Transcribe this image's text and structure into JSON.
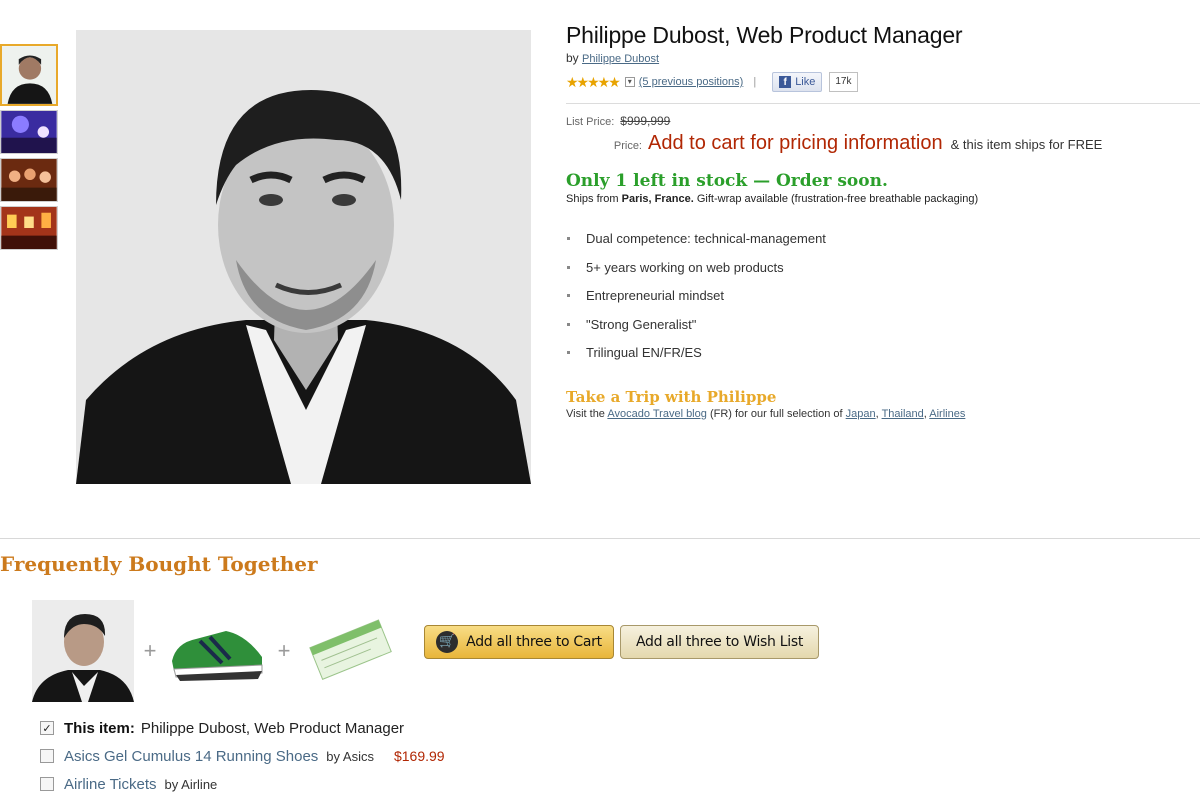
{
  "product": {
    "title": "Philippe Dubost, Web Product Manager",
    "by_label": "by",
    "author": "Philippe Dubost",
    "stars": "★★★★★",
    "reviews_link": "(5 previous positions)",
    "separator": "|",
    "fb_like": "Like",
    "fb_count": "17k"
  },
  "pricing": {
    "list_label": "List Price:",
    "list_value": "$999,999",
    "price_label": "Price:",
    "price_value": "Add to cart for pricing information",
    "ships_text": "& this item ships for FREE"
  },
  "stock": {
    "status": "Only 1 left in stock — Order soon.",
    "ships_from_label": "Ships from",
    "ships_from_value": "Paris, France.",
    "gift_text": "Gift-wrap available (frustration-free breathable packaging)"
  },
  "features": [
    "Dual competence: technical-management",
    "5+ years working on web products",
    "Entrepreneurial mindset",
    "\"Strong Generalist\"",
    "Trilingual EN/FR/ES"
  ],
  "trip": {
    "title": "Take a Trip with Philippe",
    "text_prefix": "Visit the",
    "blog_link": "Avocado Travel blog",
    "text_mid": "(FR) for our full selection of",
    "link_japan": "Japan",
    "link_thailand": "Thailand",
    "link_airlines": "Airlines"
  },
  "fbt": {
    "heading": "Frequently Bought Together",
    "plus": "+",
    "add_cart_btn": "Add all three to Cart",
    "add_wish_btn": "Add all three to Wish List",
    "items": [
      {
        "prefix": "This item:",
        "name": "Philippe Dubost, Web Product Manager",
        "by": "",
        "price": ""
      },
      {
        "prefix": "",
        "name": "Asics Gel Cumulus 14 Running Shoes",
        "by": "by Asics",
        "price": "$169.99"
      },
      {
        "prefix": "",
        "name": "Airline Tickets",
        "by": "by Airline",
        "price": ""
      }
    ]
  },
  "colors": {
    "accent_orange": "#cc7a1c",
    "stock_green": "#2b9f2b",
    "price_red": "#b12704",
    "link_blue": "#4a6a86"
  }
}
